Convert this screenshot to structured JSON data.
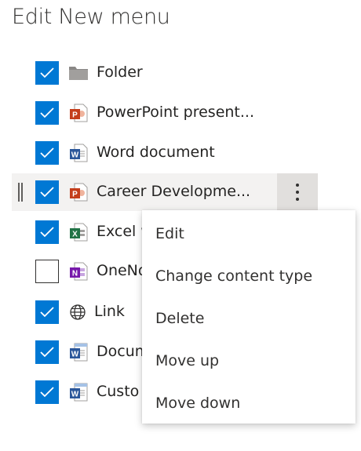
{
  "page": {
    "title": "Edit New menu"
  },
  "items": [
    {
      "label": "Folder",
      "checked": true,
      "icon": "folder-icon"
    },
    {
      "label": "PowerPoint present...",
      "checked": true,
      "icon": "powerpoint-icon"
    },
    {
      "label": "Word document",
      "checked": true,
      "icon": "word-icon"
    },
    {
      "label": "Career Developme...",
      "checked": true,
      "icon": "powerpoint-icon",
      "hovered": true
    },
    {
      "label": "Excel w",
      "checked": true,
      "icon": "excel-icon"
    },
    {
      "label": "OneNo",
      "checked": false,
      "icon": "onenote-icon"
    },
    {
      "label": "Link",
      "checked": true,
      "icon": "globe-icon"
    },
    {
      "label": "Docum",
      "checked": true,
      "icon": "word-template-icon"
    },
    {
      "label": "Custo",
      "checked": true,
      "icon": "word-template-icon"
    }
  ],
  "context_menu": {
    "items": [
      "Edit",
      "Change content type",
      "Delete",
      "Move up",
      "Move down"
    ]
  },
  "colors": {
    "accent": "#0078d4",
    "powerpoint": "#c43e1c",
    "word": "#2b579a",
    "excel": "#217346",
    "onenote": "#7719aa",
    "folder": "#8a8886"
  }
}
